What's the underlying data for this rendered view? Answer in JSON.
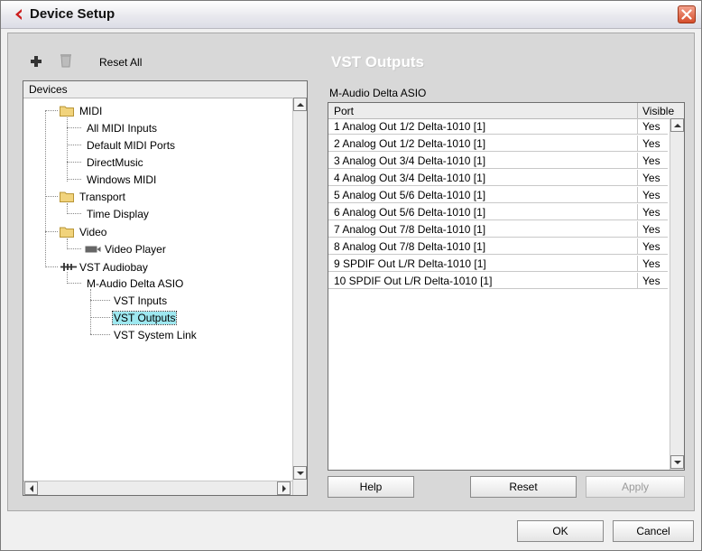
{
  "window": {
    "title": "Device Setup"
  },
  "toolbar": {
    "reset_all_label": "Reset All"
  },
  "panel_title": "VST Outputs",
  "tree": {
    "header": "Devices",
    "nodes": [
      {
        "label": "MIDI"
      },
      {
        "label": "All MIDI Inputs"
      },
      {
        "label": "Default MIDI Ports"
      },
      {
        "label": "DirectMusic"
      },
      {
        "label": "Windows MIDI"
      },
      {
        "label": "Transport"
      },
      {
        "label": "Time Display"
      },
      {
        "label": "Video"
      },
      {
        "label": "Video Player"
      },
      {
        "label": "VST Audiobay"
      },
      {
        "label": "M-Audio Delta ASIO"
      },
      {
        "label": "VST Inputs"
      },
      {
        "label": "VST Outputs"
      },
      {
        "label": "VST System Link"
      }
    ]
  },
  "device_name": "M-Audio Delta ASIO",
  "ports": {
    "columns": [
      "Port",
      "Visible"
    ],
    "rows": [
      {
        "port": "1 Analog Out 1/2 Delta-1010 [1]",
        "visible": "Yes"
      },
      {
        "port": "2 Analog Out 1/2 Delta-1010 [1]",
        "visible": "Yes"
      },
      {
        "port": "3 Analog Out 3/4 Delta-1010 [1]",
        "visible": "Yes"
      },
      {
        "port": "4 Analog Out 3/4 Delta-1010 [1]",
        "visible": "Yes"
      },
      {
        "port": "5 Analog Out 5/6 Delta-1010 [1]",
        "visible": "Yes"
      },
      {
        "port": "6 Analog Out 5/6 Delta-1010 [1]",
        "visible": "Yes"
      },
      {
        "port": "7 Analog Out 7/8 Delta-1010 [1]",
        "visible": "Yes"
      },
      {
        "port": "8 Analog Out 7/8 Delta-1010 [1]",
        "visible": "Yes"
      },
      {
        "port": "9 SPDIF Out L/R Delta-1010 [1]",
        "visible": "Yes"
      },
      {
        "port": "10 SPDIF Out L/R Delta-1010 [1]",
        "visible": "Yes"
      }
    ]
  },
  "buttons": {
    "help": "Help",
    "reset": "Reset",
    "apply": "Apply",
    "ok": "OK",
    "cancel": "Cancel"
  },
  "icons": {
    "app": "cubase-logo-icon",
    "add": "plus-icon",
    "remove": "trash-icon"
  },
  "colors": {
    "selection": "#9ee8f0",
    "close_button": "#d54d2c",
    "logo": "#cc1d1d"
  }
}
